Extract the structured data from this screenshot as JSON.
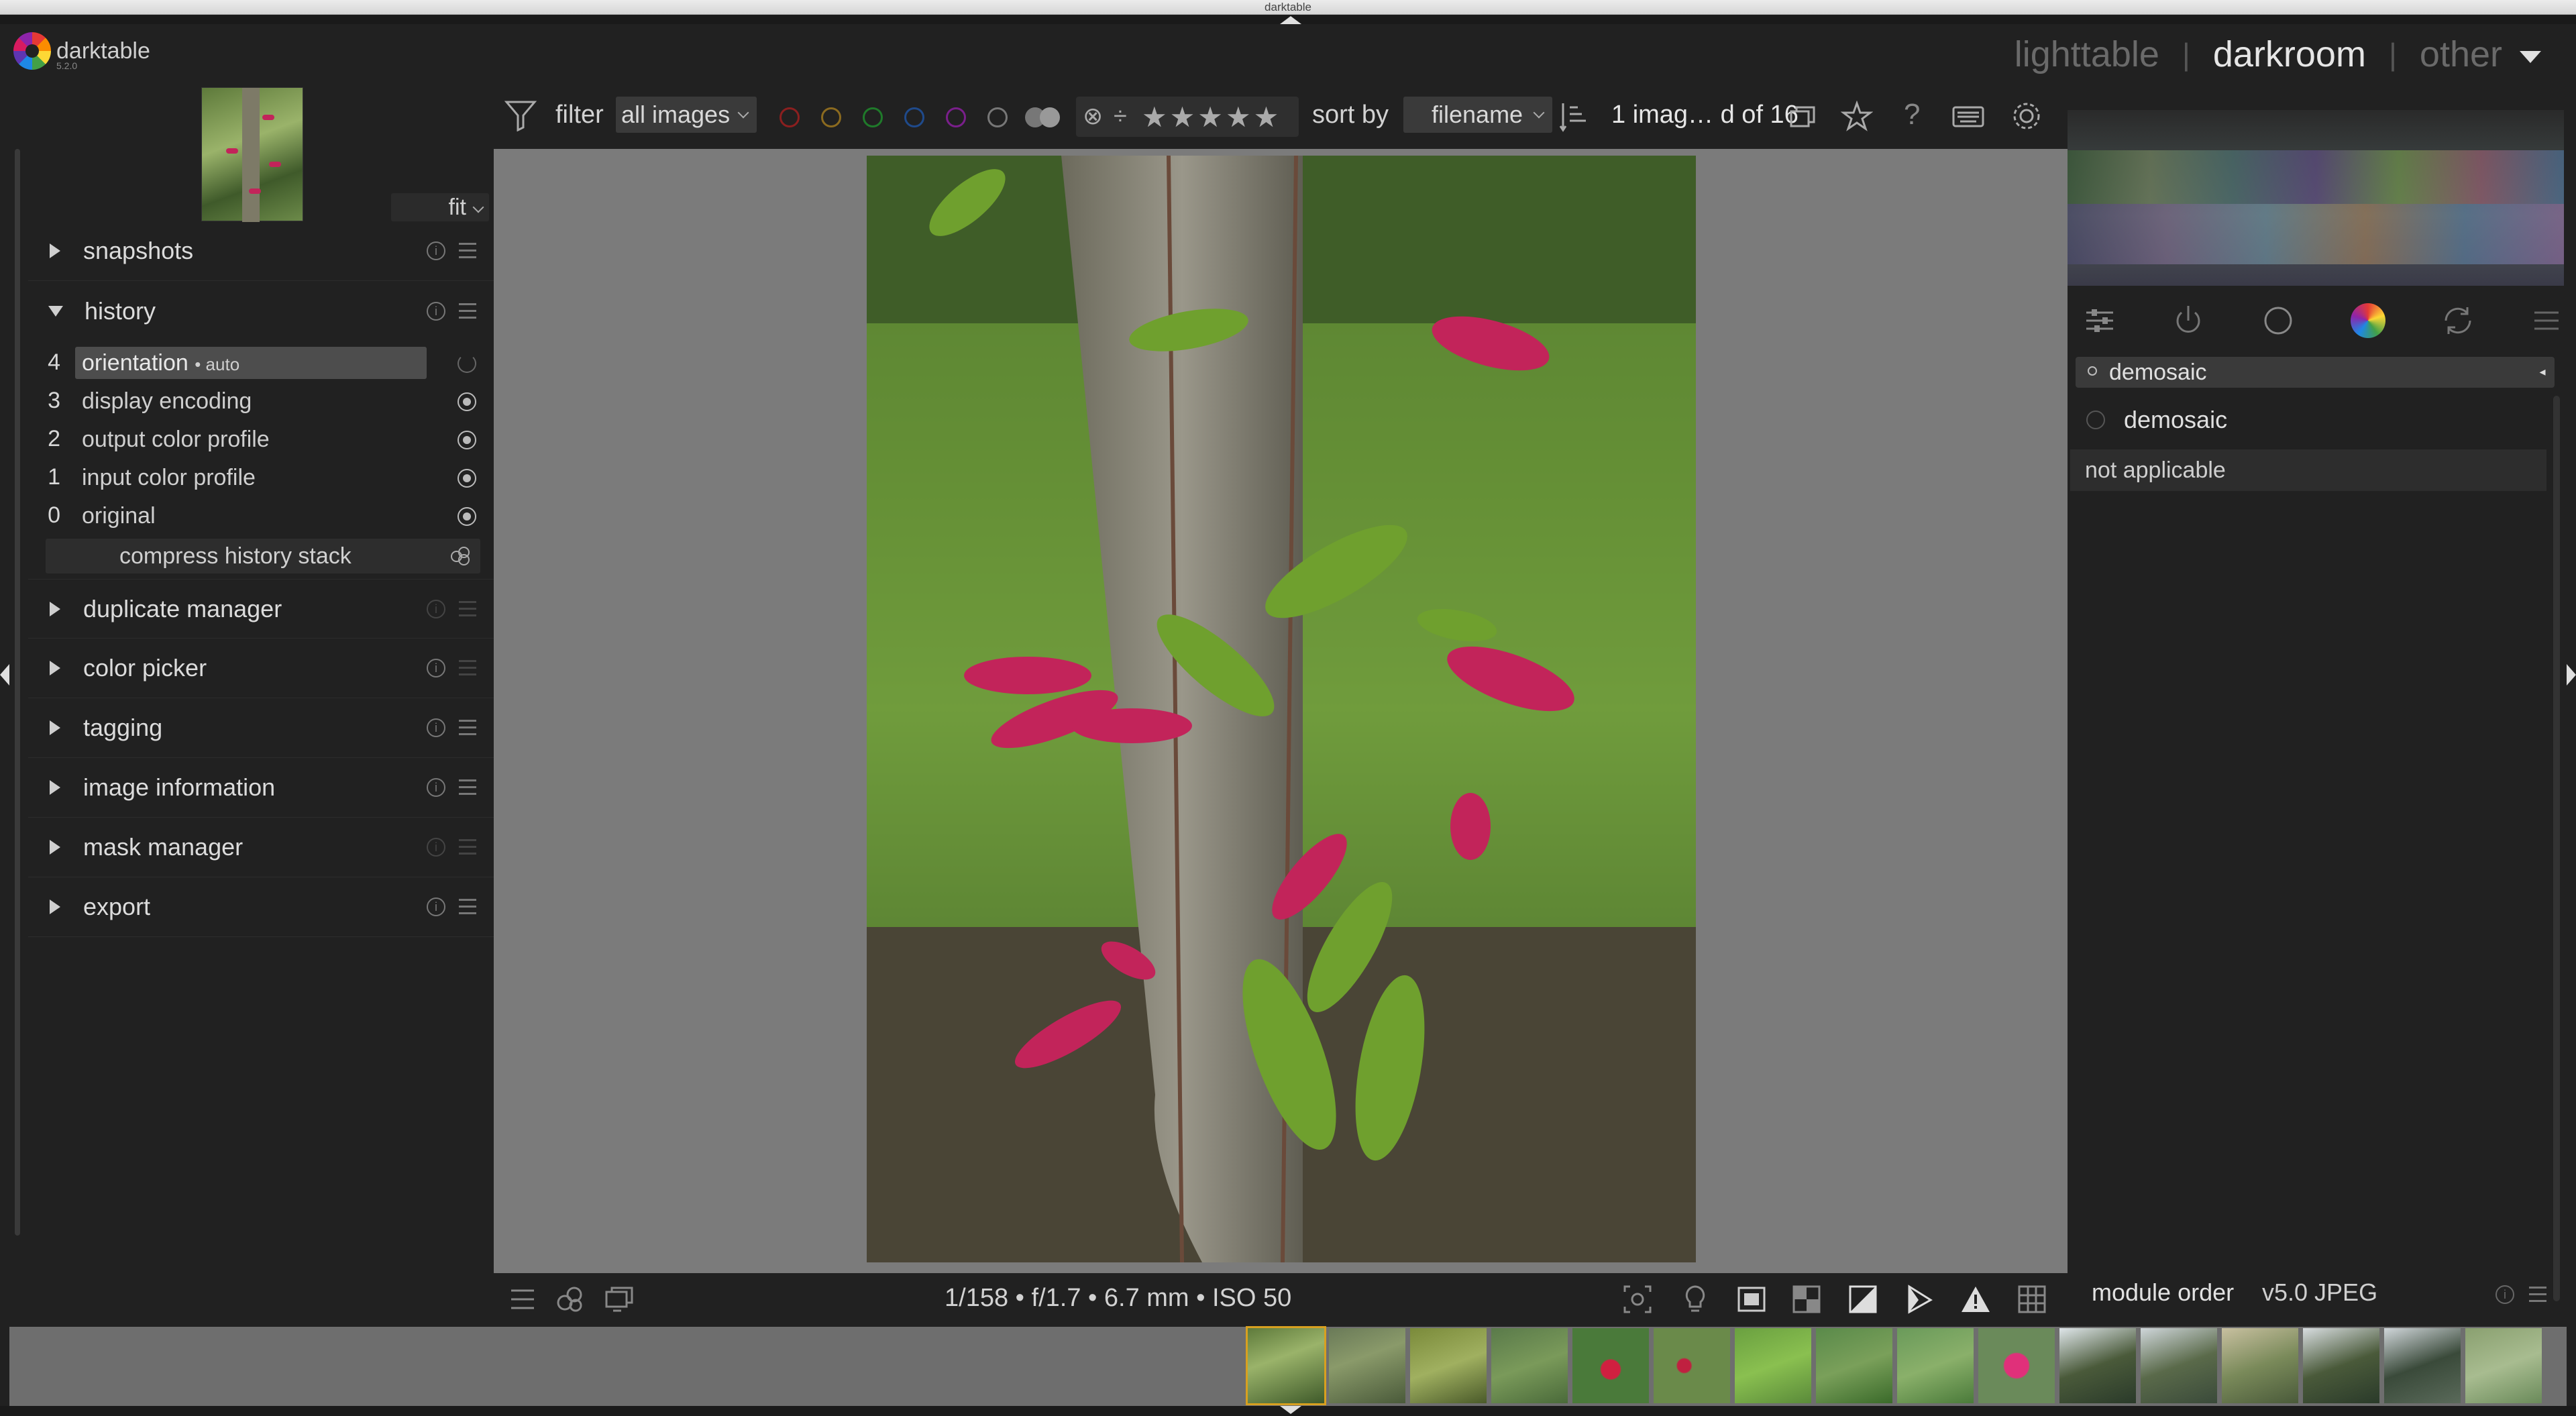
{
  "window": {
    "title": "darktable"
  },
  "app": {
    "name": "darktable",
    "version": "5.2.0"
  },
  "views": {
    "items": [
      "lighttable",
      "darkroom",
      "other"
    ],
    "active": "darkroom",
    "sep": "|"
  },
  "left_panel": {
    "zoom_select": "fit",
    "modules": [
      {
        "label": "snapshots",
        "expanded": false
      },
      {
        "label": "history",
        "expanded": true
      },
      {
        "label": "duplicate manager",
        "expanded": false
      },
      {
        "label": "color picker",
        "expanded": false
      },
      {
        "label": "tagging",
        "expanded": false
      },
      {
        "label": "image information",
        "expanded": false
      },
      {
        "label": "mask manager",
        "expanded": false
      },
      {
        "label": "export",
        "expanded": false
      }
    ],
    "history": {
      "items": [
        {
          "num": "4",
          "label": "orientation",
          "sub": "• auto",
          "selected": true
        },
        {
          "num": "3",
          "label": "display encoding"
        },
        {
          "num": "2",
          "label": "output color profile"
        },
        {
          "num": "1",
          "label": "input color profile"
        },
        {
          "num": "0",
          "label": "original"
        }
      ],
      "compress_label": "compress history stack"
    }
  },
  "top_toolbar": {
    "filter_label": "filter",
    "filter_value": "all images",
    "sort_label": "sort by",
    "sort_value": "filename",
    "count_text": "1 imag… d of 16",
    "color_labels": [
      "#8b1f1f",
      "#8b6a1f",
      "#1f7a2a",
      "#1f4a8b",
      "#7a1f8b",
      "#777777"
    ],
    "stars_text": "★★★★★"
  },
  "bottom_toolbar": {
    "exif": "1/158 • f/1.7 • 6.7 mm • ISO 50"
  },
  "right_panel": {
    "search_value": "demosaic",
    "module_name": "demosaic",
    "not_applicable": "not applicable",
    "module_order_label": "module order",
    "module_order_value": "v5.0 JPEG"
  },
  "filmstrip": {
    "count": 16
  }
}
